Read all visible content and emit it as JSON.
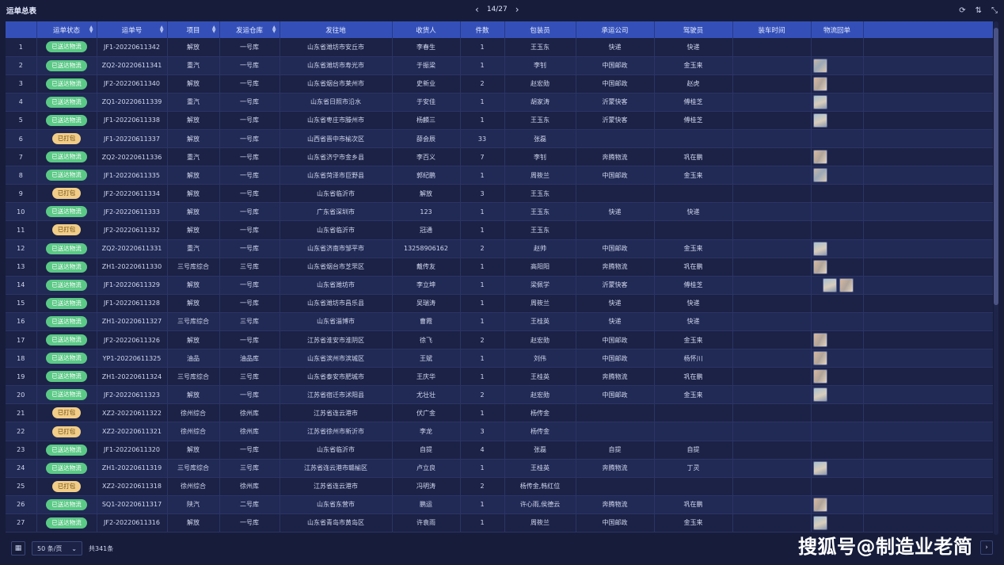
{
  "app": {
    "title": "运单总表"
  },
  "pager_top": {
    "prev_icon": "chevron-left-icon",
    "text": "14/27",
    "next_icon": "chevron-right-icon"
  },
  "toolbar_icons": [
    "refresh-icon",
    "column-settings-icon",
    "collapse-icon"
  ],
  "table": {
    "columns": [
      "",
      "运单状态",
      "运单号",
      "项目",
      "发运仓库",
      "发往地",
      "收货人",
      "件数",
      "包装员",
      "承运公司",
      "驾驶员",
      "装车时间",
      "物流回单"
    ],
    "rows": [
      {
        "no": "1",
        "status": "已送达物流",
        "status_type": "green",
        "order": "JF1-20220611342",
        "project": "解放",
        "warehouse": "一号库",
        "dest": "山东省潍坊市安丘市",
        "consignee": "李春生",
        "qty": "1",
        "packer": "王玉东",
        "carrier": "快递",
        "driver": "快递",
        "load_time": "",
        "receipts": []
      },
      {
        "no": "2",
        "status": "已送达物流",
        "status_type": "green",
        "order": "ZQ2-20220611341",
        "project": "重汽",
        "warehouse": "一号库",
        "dest": "山东省潍坊市寿光市",
        "consignee": "于振梁",
        "qty": "1",
        "packer": "李钊",
        "carrier": "中国邮政",
        "driver": "金玉来",
        "load_time": "",
        "receipts": [
          "a"
        ]
      },
      {
        "no": "3",
        "status": "已送达物流",
        "status_type": "green",
        "order": "JF2-20220611340",
        "project": "解放",
        "warehouse": "一号库",
        "dest": "山东省烟台市莱州市",
        "consignee": "史新业",
        "qty": "2",
        "packer": "赵宏勋",
        "carrier": "中国邮政",
        "driver": "赵虎",
        "load_time": "",
        "receipts": [
          "c"
        ]
      },
      {
        "no": "4",
        "status": "已送达物流",
        "status_type": "green",
        "order": "ZQ1-20220611339",
        "project": "重汽",
        "warehouse": "一号库",
        "dest": "山东省日照市沿水",
        "consignee": "于安佳",
        "qty": "1",
        "packer": "胡家涛",
        "carrier": "沂蒙快客",
        "driver": "傅桂芝",
        "load_time": "",
        "receipts": [
          "b"
        ]
      },
      {
        "no": "5",
        "status": "已送达物流",
        "status_type": "green",
        "order": "JF1-20220611338",
        "project": "解放",
        "warehouse": "一号库",
        "dest": "山东省枣庄市滕州市",
        "consignee": "杨麟三",
        "qty": "1",
        "packer": "王玉东",
        "carrier": "沂蒙快客",
        "driver": "傅桂芝",
        "load_time": "",
        "receipts": [
          "b"
        ]
      },
      {
        "no": "6",
        "status": "已打包",
        "status_type": "yellow",
        "order": "JF1-20220611337",
        "project": "解放",
        "warehouse": "一号库",
        "dest": "山西省晋中市榆次区",
        "consignee": "薛会辰",
        "qty": "33",
        "packer": "张磊",
        "carrier": "",
        "driver": "",
        "load_time": "",
        "receipts": []
      },
      {
        "no": "7",
        "status": "已送达物流",
        "status_type": "green",
        "order": "ZQ2-20220611336",
        "project": "重汽",
        "warehouse": "一号库",
        "dest": "山东省济宁市金乡县",
        "consignee": "李百义",
        "qty": "7",
        "packer": "李钊",
        "carrier": "奔腾物流",
        "driver": "巩在鹏",
        "load_time": "",
        "receipts": [
          "c"
        ]
      },
      {
        "no": "8",
        "status": "已送达物流",
        "status_type": "green",
        "order": "JF1-20220611335",
        "project": "解放",
        "warehouse": "一号库",
        "dest": "山东省菏泽市巨野县",
        "consignee": "郭纪鹏",
        "qty": "1",
        "packer": "周筱兰",
        "carrier": "中国邮政",
        "driver": "金玉来",
        "load_time": "",
        "receipts": [
          "a"
        ]
      },
      {
        "no": "9",
        "status": "已打包",
        "status_type": "yellow",
        "order": "JF2-20220611334",
        "project": "解放",
        "warehouse": "一号库",
        "dest": "山东省临沂市",
        "consignee": "解放",
        "qty": "3",
        "packer": "王玉东",
        "carrier": "",
        "driver": "",
        "load_time": "",
        "receipts": []
      },
      {
        "no": "10",
        "status": "已送达物流",
        "status_type": "green",
        "order": "JF2-20220611333",
        "project": "解放",
        "warehouse": "一号库",
        "dest": "广东省深圳市",
        "consignee": "123",
        "qty": "1",
        "packer": "王玉东",
        "carrier": "快递",
        "driver": "快递",
        "load_time": "",
        "receipts": []
      },
      {
        "no": "11",
        "status": "已打包",
        "status_type": "yellow",
        "order": "JF2-20220611332",
        "project": "解放",
        "warehouse": "一号库",
        "dest": "山东省临沂市",
        "consignee": "冠通",
        "qty": "1",
        "packer": "王玉东",
        "carrier": "",
        "driver": "",
        "load_time": "",
        "receipts": []
      },
      {
        "no": "12",
        "status": "已送达物流",
        "status_type": "green",
        "order": "ZQ2-20220611331",
        "project": "重汽",
        "warehouse": "一号库",
        "dest": "山东省济南市邹平市",
        "consignee": "13258906162",
        "qty": "2",
        "packer": "赵帅",
        "carrier": "中国邮政",
        "driver": "金玉来",
        "load_time": "",
        "receipts": [
          "b"
        ]
      },
      {
        "no": "13",
        "status": "已送达物流",
        "status_type": "green",
        "order": "ZH1-20220611330",
        "project": "三号库综合",
        "warehouse": "三号库",
        "dest": "山东省烟台市芝罘区",
        "consignee": "戴传友",
        "qty": "1",
        "packer": "高阳阳",
        "carrier": "奔腾物流",
        "driver": "巩在鹏",
        "load_time": "",
        "receipts": [
          "c"
        ]
      },
      {
        "no": "14",
        "status": "已送达物流",
        "status_type": "green",
        "order": "JF1-20220611329",
        "project": "解放",
        "warehouse": "一号库",
        "dest": "山东省潍坊市",
        "consignee": "李立坤",
        "qty": "1",
        "packer": "梁佩学",
        "carrier": "沂蒙快客",
        "driver": "傅桂芝",
        "load_time": "",
        "receipts": [
          "b",
          "c"
        ]
      },
      {
        "no": "15",
        "status": "已送达物流",
        "status_type": "green",
        "order": "JF1-20220611328",
        "project": "解放",
        "warehouse": "一号库",
        "dest": "山东省潍坊市昌乐县",
        "consignee": "吴瑞涛",
        "qty": "1",
        "packer": "周筱兰",
        "carrier": "快递",
        "driver": "快递",
        "load_time": "",
        "receipts": []
      },
      {
        "no": "16",
        "status": "已送达物流",
        "status_type": "green",
        "order": "ZH1-20220611327",
        "project": "三号库综合",
        "warehouse": "三号库",
        "dest": "山东省淄博市",
        "consignee": "曹霞",
        "qty": "1",
        "packer": "王桂英",
        "carrier": "快递",
        "driver": "快递",
        "load_time": "",
        "receipts": []
      },
      {
        "no": "17",
        "status": "已送达物流",
        "status_type": "green",
        "order": "JF2-20220611326",
        "project": "解放",
        "warehouse": "一号库",
        "dest": "江苏省淮安市淮阴区",
        "consignee": "徐飞",
        "qty": "2",
        "packer": "赵宏勋",
        "carrier": "中国邮政",
        "driver": "金玉来",
        "load_time": "",
        "receipts": [
          "c"
        ]
      },
      {
        "no": "18",
        "status": "已送达物流",
        "status_type": "green",
        "order": "YP1-20220611325",
        "project": "油品",
        "warehouse": "油品库",
        "dest": "山东省滨州市滨城区",
        "consignee": "王斌",
        "qty": "1",
        "packer": "刘伟",
        "carrier": "中国邮政",
        "driver": "杨怀川",
        "load_time": "",
        "receipts": [
          "c"
        ]
      },
      {
        "no": "19",
        "status": "已送达物流",
        "status_type": "green",
        "order": "ZH1-20220611324",
        "project": "三号库综合",
        "warehouse": "三号库",
        "dest": "山东省泰安市肥城市",
        "consignee": "王庆华",
        "qty": "1",
        "packer": "王桂英",
        "carrier": "奔腾物流",
        "driver": "巩在鹏",
        "load_time": "",
        "receipts": [
          "c"
        ]
      },
      {
        "no": "20",
        "status": "已送达物流",
        "status_type": "green",
        "order": "JF2-20220611323",
        "project": "解放",
        "warehouse": "一号库",
        "dest": "江苏省宿迁市沭阳县",
        "consignee": "尤壮壮",
        "qty": "2",
        "packer": "赵宏勋",
        "carrier": "中国邮政",
        "driver": "金玉来",
        "load_time": "",
        "receipts": [
          "b"
        ]
      },
      {
        "no": "21",
        "status": "已打包",
        "status_type": "yellow",
        "order": "XZ2-20220611322",
        "project": "徐州综合",
        "warehouse": "徐州库",
        "dest": "江苏省连云港市",
        "consignee": "伏广金",
        "qty": "1",
        "packer": "杨传金",
        "carrier": "",
        "driver": "",
        "load_time": "",
        "receipts": []
      },
      {
        "no": "22",
        "status": "已打包",
        "status_type": "yellow",
        "order": "XZ2-20220611321",
        "project": "徐州综合",
        "warehouse": "徐州库",
        "dest": "江苏省徐州市新沂市",
        "consignee": "李龙",
        "qty": "3",
        "packer": "杨传金",
        "carrier": "",
        "driver": "",
        "load_time": "",
        "receipts": []
      },
      {
        "no": "23",
        "status": "已送达物流",
        "status_type": "green",
        "order": "JF1-20220611320",
        "project": "解放",
        "warehouse": "一号库",
        "dest": "山东省临沂市",
        "consignee": "自提",
        "qty": "4",
        "packer": "张磊",
        "carrier": "自提",
        "driver": "自提",
        "load_time": "",
        "receipts": []
      },
      {
        "no": "24",
        "status": "已送达物流",
        "status_type": "green",
        "order": "ZH1-20220611319",
        "project": "三号库综合",
        "warehouse": "三号库",
        "dest": "江苏省连云港市赣榆区",
        "consignee": "卢立良",
        "qty": "1",
        "packer": "王桂英",
        "carrier": "奔腾物流",
        "driver": "丁灵",
        "load_time": "",
        "receipts": [
          "b"
        ]
      },
      {
        "no": "25",
        "status": "已打包",
        "status_type": "yellow",
        "order": "XZ2-20220611318",
        "project": "徐州综合",
        "warehouse": "徐州库",
        "dest": "江苏省连云港市",
        "consignee": "冯明涛",
        "qty": "2",
        "packer": "杨传金,韩红位",
        "carrier": "",
        "driver": "",
        "load_time": "",
        "receipts": []
      },
      {
        "no": "26",
        "status": "已送达物流",
        "status_type": "green",
        "order": "SQ1-20220611317",
        "project": "陕汽",
        "warehouse": "二号库",
        "dest": "山东省东营市",
        "consignee": "鹏运",
        "qty": "1",
        "packer": "许心雨,侯德云",
        "carrier": "奔腾物流",
        "driver": "巩在鹏",
        "load_time": "",
        "receipts": [
          "c"
        ]
      },
      {
        "no": "27",
        "status": "已送达物流",
        "status_type": "green",
        "order": "JF2-20220611316",
        "project": "解放",
        "warehouse": "一号库",
        "dest": "山东省青岛市黄岛区",
        "consignee": "许袁雨",
        "qty": "1",
        "packer": "周筱兰",
        "carrier": "中国邮政",
        "driver": "金玉来",
        "load_time": "",
        "receipts": [
          "b"
        ]
      }
    ]
  },
  "footer": {
    "grid_icon": "grid-icon",
    "page_size": "50 条/页",
    "total": "共341条",
    "next_icon": "chevron-right-icon"
  },
  "watermark": "搜狐号@制造业老简",
  "colors": {
    "header_bg": "#3450b8",
    "badge_green": "#5bc986",
    "badge_yellow": "#f1cd88",
    "page_bg": "#161c3a"
  }
}
